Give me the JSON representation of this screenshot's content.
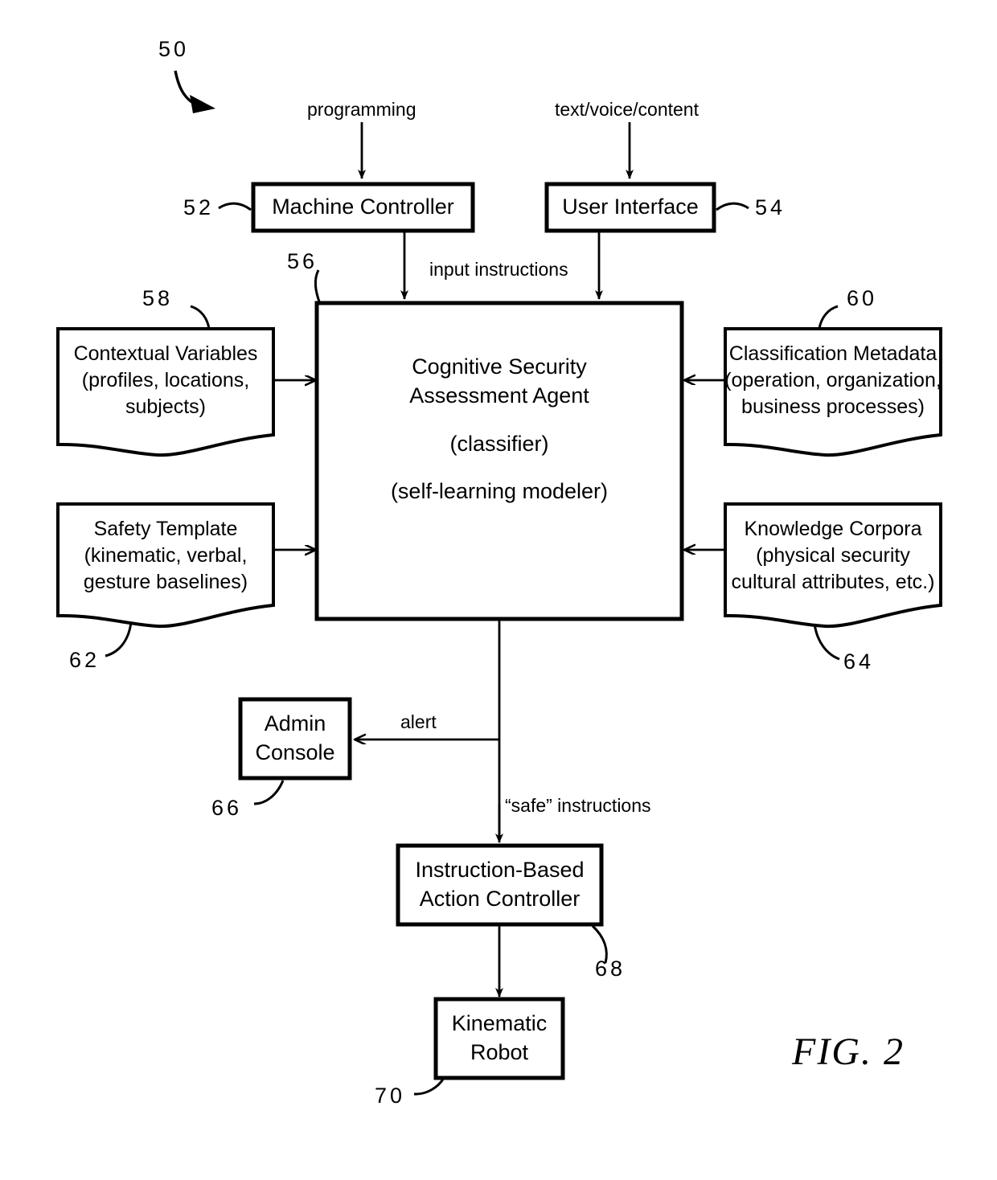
{
  "figure": {
    "caption": "FIG. 2",
    "system_ref": "50"
  },
  "inputs": [
    {
      "id": "programming",
      "label": "programming"
    },
    {
      "id": "text-voice-content",
      "label": "text/voice/content"
    }
  ],
  "nodes": {
    "machine_controller": {
      "label": "Machine Controller",
      "ref": "52"
    },
    "user_interface": {
      "label": "User Interface",
      "ref": "54"
    },
    "agent": {
      "title_line1": "Cognitive Security",
      "title_line2": "Assessment Agent",
      "role1": "(classifier)",
      "role2": "(self-learning modeler)",
      "ref": "56"
    },
    "contextual_variables": {
      "line1": "Contextual Variables",
      "line2": "(profiles, locations,",
      "line3": "subjects)",
      "ref": "58"
    },
    "classification_metadata": {
      "line1": "Classification Metadata",
      "line2": "(operation, organization,",
      "line3": "business processes)",
      "ref": "60"
    },
    "safety_template": {
      "line1": "Safety Template",
      "line2": "(kinematic, verbal,",
      "line3": "gesture baselines)",
      "ref": "62"
    },
    "knowledge_corpora": {
      "line1": "Knowledge Corpora",
      "line2": "(physical security",
      "line3": "cultural attributes, etc.)",
      "ref": "64"
    },
    "admin_console": {
      "line1": "Admin",
      "line2": "Console",
      "ref": "66"
    },
    "action_controller": {
      "line1": "Instruction-Based",
      "line2": "Action Controller",
      "ref": "68"
    },
    "kinematic_robot": {
      "line1": "Kinematic",
      "line2": "Robot",
      "ref": "70"
    }
  },
  "edges": {
    "input_instructions": "input instructions",
    "alert": "alert",
    "safe_instructions": "“safe” instructions"
  },
  "colors": {
    "stroke": "#000000",
    "background": "#ffffff"
  }
}
